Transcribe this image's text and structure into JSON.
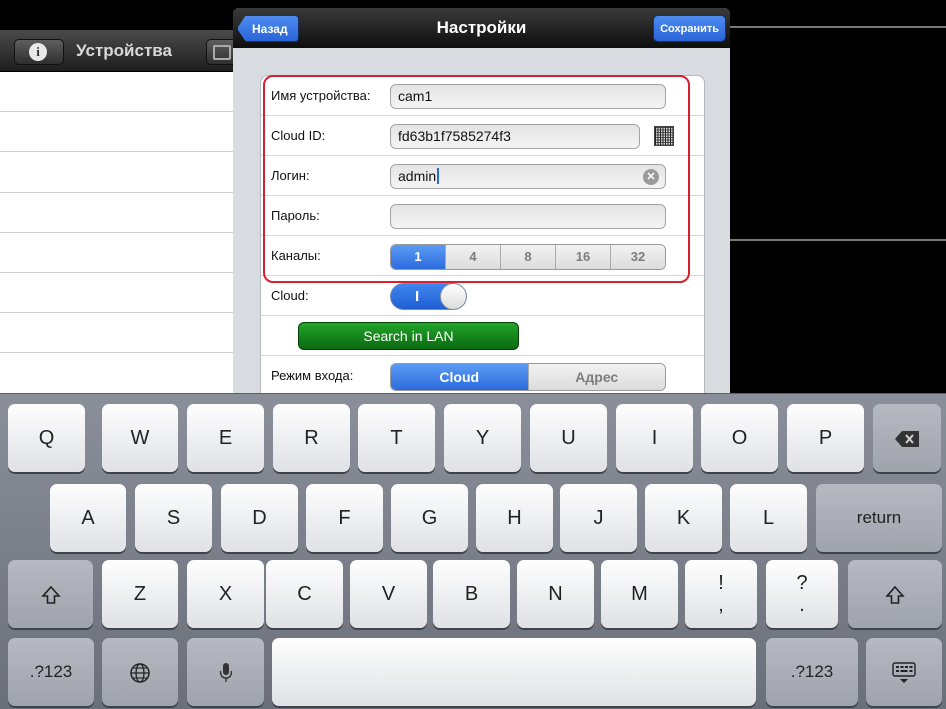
{
  "background": {
    "title": "Устройства"
  },
  "modal": {
    "back_label": "Назад",
    "title": "Настройки",
    "save_label": "Сохранить",
    "form": {
      "device_name_label": "Имя устройства:",
      "device_name_value": "cam1",
      "cloud_id_label": "Cloud ID:",
      "cloud_id_value": "fd63b1f7585274f3",
      "login_label": "Логин:",
      "login_value": "admin",
      "password_label": "Пароль:",
      "password_value": "",
      "channels_label": "Каналы:",
      "channels_options": [
        "1",
        "4",
        "8",
        "16",
        "32"
      ],
      "channels_selected": "1",
      "cloud_label": "Cloud:",
      "cloud_toggle_text": "I",
      "cloud_toggle_state": "on",
      "search_lan_label": "Search in LAN",
      "login_mode_label": "Режим входа:",
      "login_mode_options": [
        "Cloud",
        "Адрес"
      ],
      "login_mode_selected": "Cloud"
    }
  },
  "keyboard": {
    "row1": [
      "Q",
      "W",
      "E",
      "R",
      "T",
      "Y",
      "U",
      "I",
      "O",
      "P"
    ],
    "row2": [
      "A",
      "S",
      "D",
      "F",
      "G",
      "H",
      "J",
      "K",
      "L"
    ],
    "row3": [
      "Z",
      "X",
      "C",
      "V",
      "B",
      "N",
      "M"
    ],
    "row3_punct": [
      [
        "!",
        ","
      ],
      [
        "?",
        "."
      ]
    ],
    "return_label": "return",
    "numbers_label": ".?123",
    "icons": {
      "backspace": "backspace-icon",
      "shift": "shift-icon",
      "globe": "globe-icon",
      "mic": "microphone-icon",
      "hide": "hide-keyboard-icon",
      "clear": "clear-text-icon",
      "qr": "qr-code-icon",
      "info": "info-icon"
    }
  },
  "colors": {
    "accent_blue": "#2c6bdc",
    "search_green": "#0f7a16",
    "highlight_red": "#d82030"
  }
}
